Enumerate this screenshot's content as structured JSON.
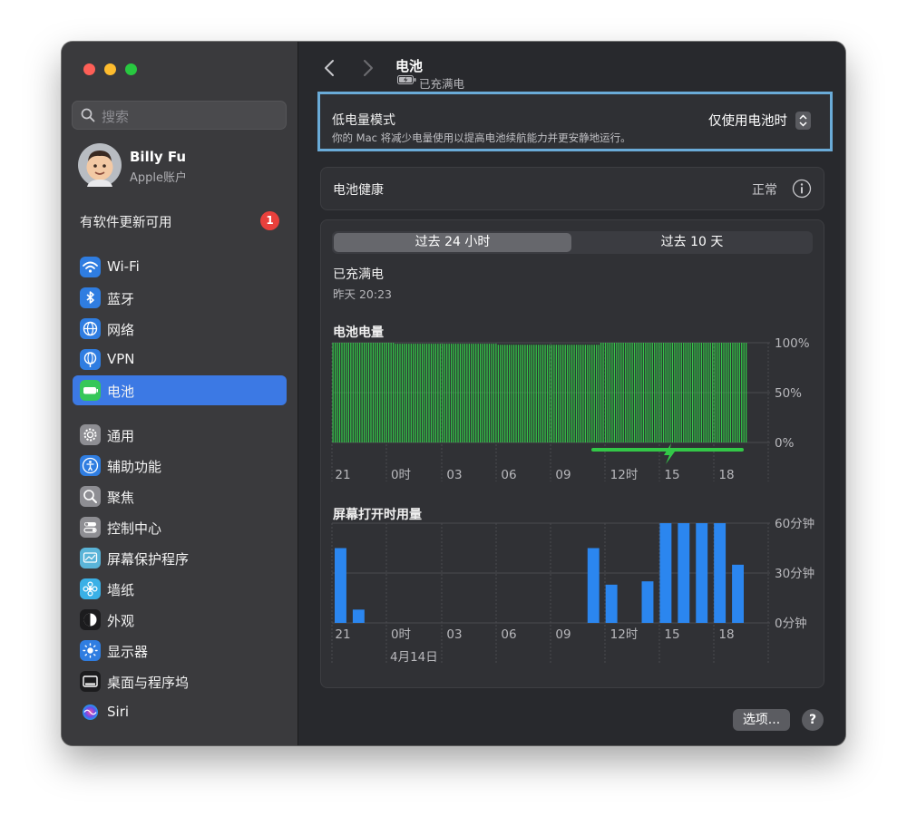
{
  "sidebar": {
    "search_placeholder": "搜索",
    "user": {
      "name": "Billy Fu",
      "subtitle": "Apple账户"
    },
    "update": {
      "label": "有软件更新可用",
      "badge": "1"
    },
    "items": [
      {
        "label": "Wi-Fi",
        "icon": "wifi-icon",
        "color": "#2f7de1",
        "active": false
      },
      {
        "label": "蓝牙",
        "icon": "bluetooth-icon",
        "color": "#2f7de1",
        "active": false
      },
      {
        "label": "网络",
        "icon": "globe-icon",
        "color": "#2f7de1",
        "active": false
      },
      {
        "label": "VPN",
        "icon": "vpn-globe-icon",
        "color": "#2f7de1",
        "active": false
      },
      {
        "label": "电池",
        "icon": "battery-icon",
        "color": "#35c759",
        "active": true
      },
      {
        "label": "通用",
        "icon": "gear-icon",
        "color": "#8e8e93",
        "active": false
      },
      {
        "label": "辅助功能",
        "icon": "accessibility-icon",
        "color": "#2f7de1",
        "active": false
      },
      {
        "label": "聚焦",
        "icon": "magnifier-icon",
        "color": "#8e8e93",
        "active": false
      },
      {
        "label": "控制中心",
        "icon": "control-center-icon",
        "color": "#8e8e93",
        "active": false
      },
      {
        "label": "屏幕保护程序",
        "icon": "screensaver-icon",
        "color": "#5ab4d8",
        "active": false
      },
      {
        "label": "墙纸",
        "icon": "wallpaper-icon",
        "color": "#3ab0e6",
        "active": false
      },
      {
        "label": "外观",
        "icon": "appearance-icon",
        "color": "#1c1c1e",
        "active": false
      },
      {
        "label": "显示器",
        "icon": "display-icon",
        "color": "#2f7de1",
        "active": false
      },
      {
        "label": "桌面与程序坞",
        "icon": "dock-icon",
        "color": "#1c1c1e",
        "active": false
      },
      {
        "label": "Siri",
        "icon": "siri-icon",
        "color": "#7a4de0",
        "active": false
      }
    ]
  },
  "header": {
    "title": "电池",
    "subtitle": "已充满电"
  },
  "low_power": {
    "title": "低电量模式",
    "description": "你的 Mac 将减少电量使用以提高电池续航能力并更安静地运行。",
    "value": "仅使用电池时"
  },
  "health": {
    "label": "电池健康",
    "value": "正常"
  },
  "usage": {
    "tabs": [
      {
        "label": "过去 24 小时",
        "active": true
      },
      {
        "label": "过去 10 天",
        "active": false
      }
    ],
    "status": "已充满电",
    "status_time": "昨天 20:23",
    "date_label": "4月14日"
  },
  "footer": {
    "options_label": "选项...",
    "help_label": "?"
  },
  "colors": {
    "battery_green": "#33c748",
    "screen_blue": "#2b86ef",
    "accent": "#3c79e4"
  },
  "chart_data": [
    {
      "type": "bar",
      "title": "电池电量",
      "x_ticks": [
        "21",
        "0时",
        "03",
        "06",
        "09",
        "12时",
        "15",
        "18"
      ],
      "y_ticks": [
        "100%",
        "50%",
        "0%"
      ],
      "ylim": [
        0,
        100
      ],
      "interval_minutes": 15,
      "values": [
        100,
        100,
        100,
        100,
        100,
        100,
        100,
        100,
        100,
        100,
        100,
        100,
        100,
        100,
        100,
        100,
        100,
        100,
        100,
        100,
        100,
        100,
        100,
        100,
        100,
        100,
        100,
        100,
        99,
        99,
        99,
        99,
        99,
        99,
        99,
        99,
        99,
        99,
        99,
        99,
        99,
        99,
        99,
        99,
        99,
        99,
        99,
        99,
        99,
        99,
        99,
        99,
        99,
        99,
        99,
        99,
        99,
        99,
        99,
        99,
        99,
        99,
        99,
        99,
        99,
        99,
        99,
        99,
        99,
        99,
        99,
        99,
        99,
        99,
        98,
        98,
        98,
        98,
        98,
        98,
        98,
        98,
        98,
        98,
        98,
        98,
        98,
        98,
        98,
        98,
        98,
        98,
        98,
        98,
        98,
        98,
        98,
        98,
        98,
        98,
        98,
        98,
        98,
        98,
        98,
        98,
        98,
        98,
        98,
        98,
        98,
        98,
        98,
        98,
        98,
        98,
        98,
        98,
        98,
        98,
        100,
        100,
        100,
        100,
        100,
        100,
        100,
        100,
        100,
        100,
        100,
        100,
        100,
        100,
        100,
        100,
        100,
        100,
        100,
        100,
        100,
        100,
        100,
        100,
        100,
        100,
        100,
        100,
        100,
        100,
        100,
        100,
        100,
        100,
        100,
        100,
        100,
        100,
        100,
        100,
        100,
        100,
        100,
        100,
        100,
        100,
        100,
        100,
        100,
        100,
        100,
        100,
        100,
        100,
        100,
        100,
        100,
        100,
        100,
        100,
        100,
        100,
        100,
        100,
        100,
        100
      ],
      "charging_range": [
        12,
        18.8
      ]
    },
    {
      "type": "bar",
      "title": "屏幕打开时用量",
      "x_ticks": [
        "21",
        "0时",
        "03",
        "06",
        "09",
        "12时",
        "15",
        "18"
      ],
      "y_ticks": [
        "60分钟",
        "30分钟",
        "0分钟"
      ],
      "ylim": [
        0,
        60
      ],
      "x_start": 21,
      "values": [
        45,
        8,
        0,
        0,
        0,
        0,
        0,
        0,
        0,
        0,
        0,
        0,
        0,
        0,
        45,
        23,
        0,
        25,
        60,
        60,
        60,
        60,
        35
      ]
    }
  ]
}
